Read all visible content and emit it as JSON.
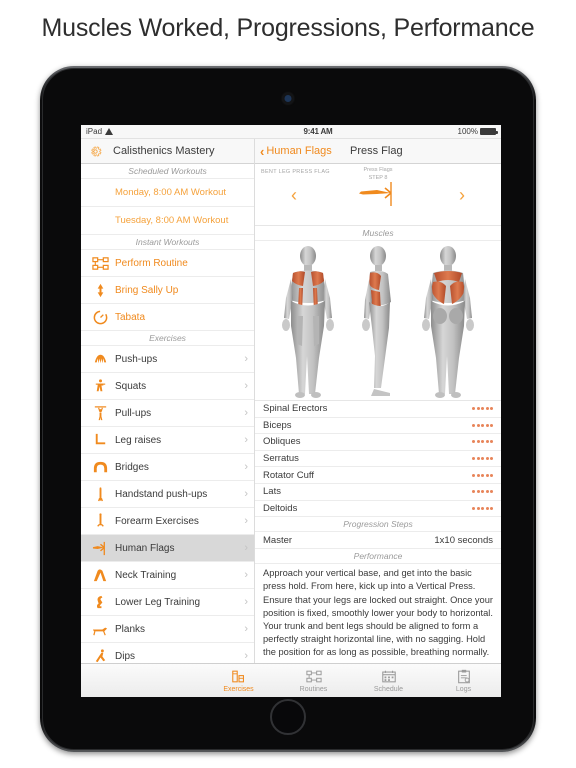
{
  "page_title": "Muscles Worked, Progressions, Performance",
  "status_bar": {
    "device": "iPad",
    "wifi_icon": "wifi-icon",
    "time": "9:41 AM",
    "battery_percent": "100%",
    "battery_icon": "battery-icon"
  },
  "sidebar": {
    "settings_icon": "gear-icon",
    "app_title": "Calisthenics Mastery",
    "sections": [
      {
        "header": "Scheduled Workouts",
        "rows": [
          {
            "label": "Monday, 8:00 AM Workout",
            "style": "sched",
            "icon": "",
            "chevron": ""
          },
          {
            "label": "Tuesday, 8:00 AM Workout",
            "style": "sched",
            "icon": "",
            "chevron": ""
          }
        ]
      },
      {
        "header": "Instant Workouts",
        "rows": [
          {
            "label": "Perform Routine",
            "style": "instant",
            "icon": "routine-icon",
            "chevron": ""
          },
          {
            "label": "Bring Sally Up",
            "style": "instant",
            "icon": "updown-arrow-icon",
            "chevron": ""
          },
          {
            "label": "Tabata",
            "style": "instant",
            "icon": "timer-icon",
            "chevron": ""
          }
        ]
      },
      {
        "header": "Exercises",
        "rows": [
          {
            "label": "Push-ups",
            "style": "ex",
            "icon": "pushup-icon",
            "chevron": "›"
          },
          {
            "label": "Squats",
            "style": "ex",
            "icon": "squat-icon",
            "chevron": "›"
          },
          {
            "label": "Pull-ups",
            "style": "ex",
            "icon": "pullup-icon",
            "chevron": "›"
          },
          {
            "label": "Leg raises",
            "style": "ex",
            "icon": "legraise-icon",
            "chevron": "›"
          },
          {
            "label": "Bridges",
            "style": "ex",
            "icon": "bridge-icon",
            "chevron": "›"
          },
          {
            "label": "Handstand push-ups",
            "style": "ex",
            "icon": "handstand-icon",
            "chevron": "›"
          },
          {
            "label": "Forearm Exercises",
            "style": "ex",
            "icon": "forearm-icon",
            "chevron": "›"
          },
          {
            "label": "Human Flags",
            "style": "ex selected",
            "icon": "humanflag-icon",
            "chevron": "›"
          },
          {
            "label": "Neck Training",
            "style": "ex",
            "icon": "neck-icon",
            "chevron": "›"
          },
          {
            "label": "Lower Leg Training",
            "style": "ex",
            "icon": "lowerleg-icon",
            "chevron": "›"
          },
          {
            "label": "Planks",
            "style": "ex",
            "icon": "plank-icon",
            "chevron": "›"
          },
          {
            "label": "Dips",
            "style": "ex",
            "icon": "dip-icon",
            "chevron": "›"
          }
        ]
      }
    ]
  },
  "detail": {
    "back_label": "Human Flags",
    "back_caret": "‹",
    "title": "Press Flag",
    "step_nav": {
      "prev_step_label": "BENT LEG PRESS FLAG",
      "current_name": "Press Flags",
      "current_step": "STEP 8",
      "prev_arrow": "‹",
      "next_arrow": "›"
    },
    "muscles_header": "Muscles",
    "muscles": [
      {
        "name": "Spinal Erectors",
        "dots": 5
      },
      {
        "name": "Biceps",
        "dots": 5
      },
      {
        "name": "Obliques",
        "dots": 5
      },
      {
        "name": "Serratus",
        "dots": 5
      },
      {
        "name": "Rotator Cuff",
        "dots": 5
      },
      {
        "name": "Lats",
        "dots": 5
      },
      {
        "name": "Deltoids",
        "dots": 5
      }
    ],
    "progression_header": "Progression Steps",
    "progression_rows": [
      {
        "name": "Master",
        "value": "1x10 seconds"
      }
    ],
    "performance_header": "Performance",
    "performance_text": "Approach your vertical base, and get into the basic press hold. From here, kick up into a Vertical Press. Ensure that your legs are locked out straight. Once your position is fixed, smoothly lower your body to horizontal. Your trunk and bent legs should be aligned to form a perfectly straight horizontal line, with no sagging. Hold the position for as long as possible, breathing normally."
  },
  "tab_bar": {
    "tabs": [
      {
        "label": "Exercises",
        "icon": "exercises-icon",
        "active": true
      },
      {
        "label": "Routines",
        "icon": "routines-icon",
        "active": false
      },
      {
        "label": "Schedule",
        "icon": "schedule-icon",
        "active": false
      },
      {
        "label": "Logs",
        "icon": "logs-icon",
        "active": false
      }
    ]
  },
  "colors": {
    "accent": "#f08a1e",
    "accent_light": "#f5a23c",
    "muscle_highlight": "#d4613c",
    "selected_row": "#d8d8d8"
  }
}
